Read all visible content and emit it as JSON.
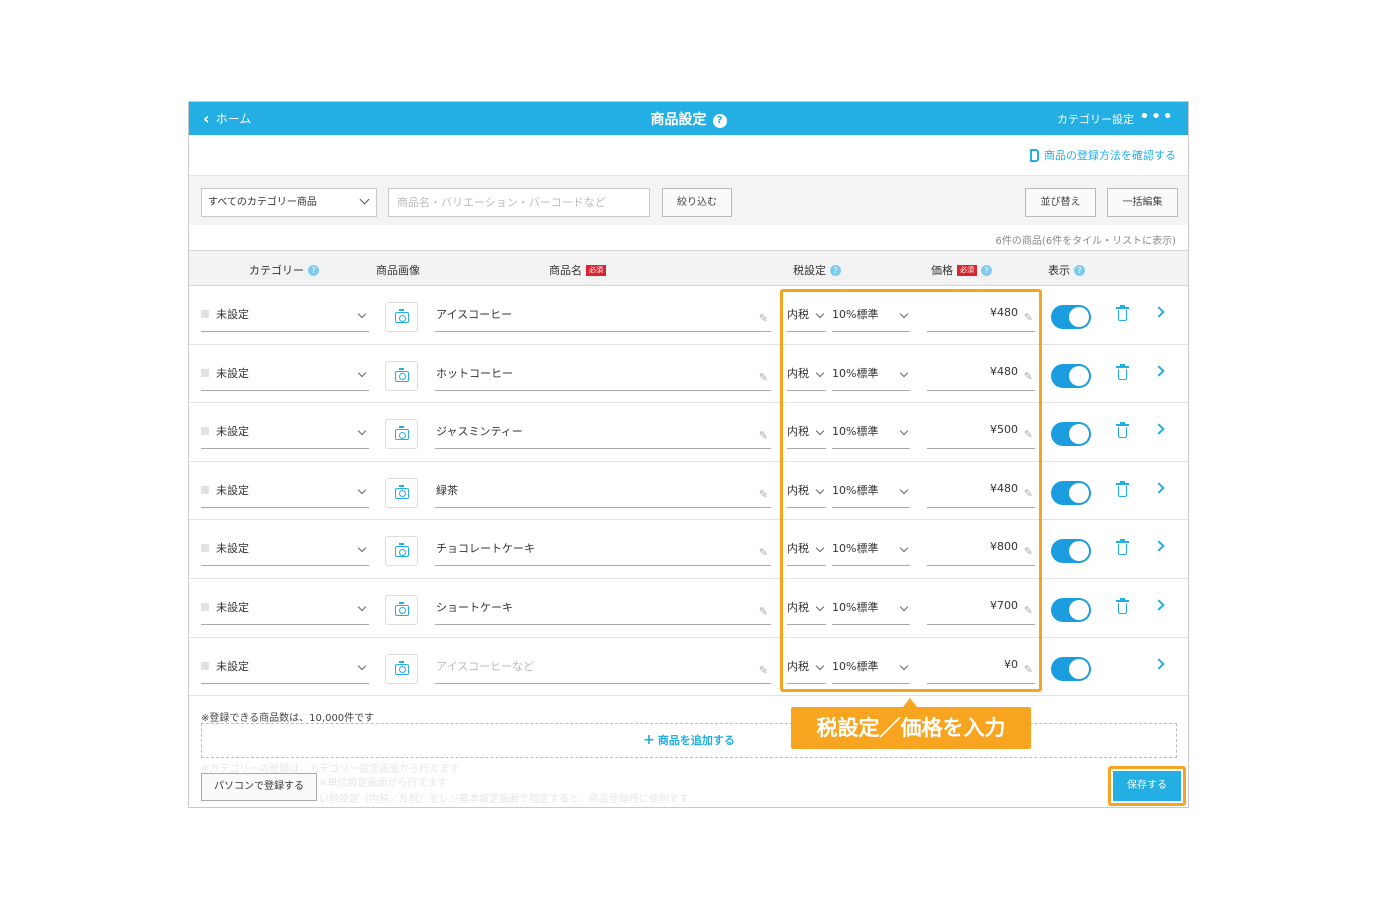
{
  "header": {
    "back_label": "ホーム",
    "title": "商品設定",
    "help_glyph": "?",
    "category_setting": "カテゴリー設定",
    "more_glyph": "•••"
  },
  "guide_link": "商品の登録方法を確認する",
  "filter": {
    "category_select": "すべてのカテゴリー商品",
    "search_placeholder": "商品名・バリエーション・バーコードなど",
    "narrow_button": "絞り込む",
    "sort_button": "並び替え",
    "bulk_edit_button": "一括編集"
  },
  "count_text": "6件の商品(6件をタイル・リストに表示)",
  "table_headers": {
    "category": "カテゴリー",
    "image": "商品画像",
    "name": "商品名",
    "tax": "税設定",
    "price": "価格",
    "visible": "表示",
    "required_badge": "必須"
  },
  "rows": [
    {
      "category": "未設定",
      "name": "アイスコーヒー",
      "tax": "内税",
      "rate": "10%標準",
      "price": "¥480",
      "visible": true
    },
    {
      "category": "未設定",
      "name": "ホットコーヒー",
      "tax": "内税",
      "rate": "10%標準",
      "price": "¥480",
      "visible": true
    },
    {
      "category": "未設定",
      "name": "ジャスミンティー",
      "tax": "内税",
      "rate": "10%標準",
      "price": "¥500",
      "visible": true
    },
    {
      "category": "未設定",
      "name": "緑茶",
      "tax": "内税",
      "rate": "10%標準",
      "price": "¥480",
      "visible": true
    },
    {
      "category": "未設定",
      "name": "チョコレートケーキ",
      "tax": "内税",
      "rate": "10%標準",
      "price": "¥800",
      "visible": true
    },
    {
      "category": "未設定",
      "name": "ショートケーキ",
      "tax": "内税",
      "rate": "10%標準",
      "price": "¥700",
      "visible": true
    },
    {
      "category": "未設定",
      "name_placeholder": "アイスコーヒーなど",
      "tax": "内税",
      "rate": "10%標準",
      "price": "¥0",
      "visible": true
    }
  ],
  "footer": {
    "limit_note": "※登録できる商品数は、10,000件です",
    "add_product": "商品を追加する",
    "pc_register": "パソコンで登録する",
    "save": "保存する",
    "faint_line_1": "※カテゴリーの登録は、カテゴリー設定画面から行えます",
    "faint_line_2": "※単位設定画面から行えます",
    "faint_line_3": "い税設定（内税／外税）をレジ基本設定画面で指定すると、商品登録時に便利です"
  },
  "callout_text": "税設定／価格を入力",
  "colors": {
    "brand_blue": "#23aee4",
    "highlight_orange": "#f7a521",
    "required_red": "#d8262f"
  }
}
